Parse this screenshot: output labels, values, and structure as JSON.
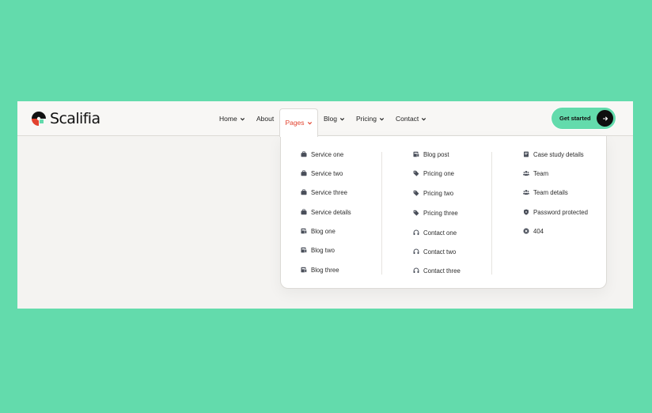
{
  "brand": {
    "name": "Scalifia"
  },
  "nav": {
    "items": [
      {
        "label": "Home",
        "has_dropdown": true
      },
      {
        "label": "About",
        "has_dropdown": false
      },
      {
        "label": "Pages",
        "has_dropdown": true,
        "active": true
      },
      {
        "label": "Blog",
        "has_dropdown": true
      },
      {
        "label": "Pricing",
        "has_dropdown": true
      },
      {
        "label": "Contact",
        "has_dropdown": true
      }
    ],
    "cta_label": "Get started"
  },
  "menu": {
    "columns": [
      [
        {
          "label": "Service one",
          "icon": "briefcase-icon"
        },
        {
          "label": "Service two",
          "icon": "briefcase-icon"
        },
        {
          "label": "Service three",
          "icon": "briefcase-icon"
        },
        {
          "label": "Service details",
          "icon": "briefcase-icon"
        },
        {
          "label": "Blog one",
          "icon": "newspaper-icon"
        },
        {
          "label": "Blog two",
          "icon": "newspaper-icon"
        },
        {
          "label": "Blog three",
          "icon": "newspaper-icon"
        }
      ],
      [
        {
          "label": "Blog post",
          "icon": "newspaper-icon"
        },
        {
          "label": "Pricing one",
          "icon": "tag-icon"
        },
        {
          "label": "Pricing two",
          "icon": "tag-icon"
        },
        {
          "label": "Pricing three",
          "icon": "tag-icon"
        },
        {
          "label": "Contact one",
          "icon": "headset-icon"
        },
        {
          "label": "Contact two",
          "icon": "headset-icon"
        },
        {
          "label": "Contact three",
          "icon": "headset-icon"
        }
      ],
      [
        {
          "label": "Case study details",
          "icon": "document-icon"
        },
        {
          "label": "Team",
          "icon": "team-icon"
        },
        {
          "label": "Team details",
          "icon": "team-icon"
        },
        {
          "label": "Password protected",
          "icon": "shield-icon"
        },
        {
          "label": "404",
          "icon": "error-icon"
        }
      ]
    ]
  },
  "colors": {
    "background": "#63dbac",
    "accent": "#63dbac",
    "active_nav": "#e2422e",
    "cta_arrow_bg": "#0e0e0e"
  }
}
